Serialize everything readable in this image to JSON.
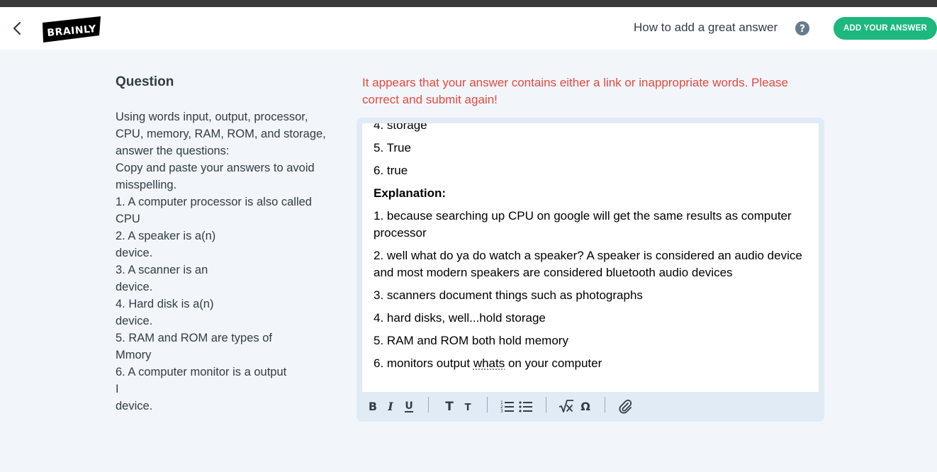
{
  "header": {
    "logo_text": "BRAINLY",
    "how_to_label": "How to add a great answer",
    "add_answer_label": "ADD YOUR ANSWER"
  },
  "question": {
    "title": "Question",
    "lines": [
      "Using words input, output, processor,",
      "CPU, memory, RAM, ROM, and storage,",
      "answer the questions:",
      "Copy and paste your answers to avoid",
      "misspelling.",
      "1. A computer processor is also called",
      "CPU",
      "2. A speaker is a(n)",
      "device.",
      "3. A scanner is an",
      "device.",
      "4. Hard disk is a(n)",
      "device.",
      "5. RAM and ROM are types of",
      "Mmory",
      "6. A computer monitor is a output",
      "I",
      "device."
    ]
  },
  "error_message": "It appears that your answer contains either a link or inappropriate words. Please correct and submit again!",
  "answer": {
    "answers": [
      "4. storage",
      "5. True",
      "6. true"
    ],
    "explanation_heading": "Explanation:",
    "explanations": [
      "1. because searching up CPU on google will get the same results as computer processor",
      "2. well what do ya do watch a speaker? A speaker is considered an audio device and most modern speakers are considered bluetooth audio devices",
      "3. scanners document things such as photographs",
      "4. hard disks, well...hold storage",
      "5. RAM and ROM both hold memory"
    ],
    "last_line": {
      "before": "6. monitors output ",
      "misspelled": "whats",
      "after": " on your computer"
    }
  },
  "toolbar": {
    "icons": [
      "bold-icon",
      "italic-icon",
      "underline-icon",
      "text-large-icon",
      "text-small-icon",
      "numbered-list-icon",
      "bullet-list-icon",
      "math-formula-icon",
      "special-character-icon",
      "attachment-icon"
    ]
  },
  "colors": {
    "brand_green": "#1cb87e",
    "error_red": "#e4493f",
    "page_bg": "#f2f6fa",
    "editor_frame": "#e1ebf5"
  }
}
